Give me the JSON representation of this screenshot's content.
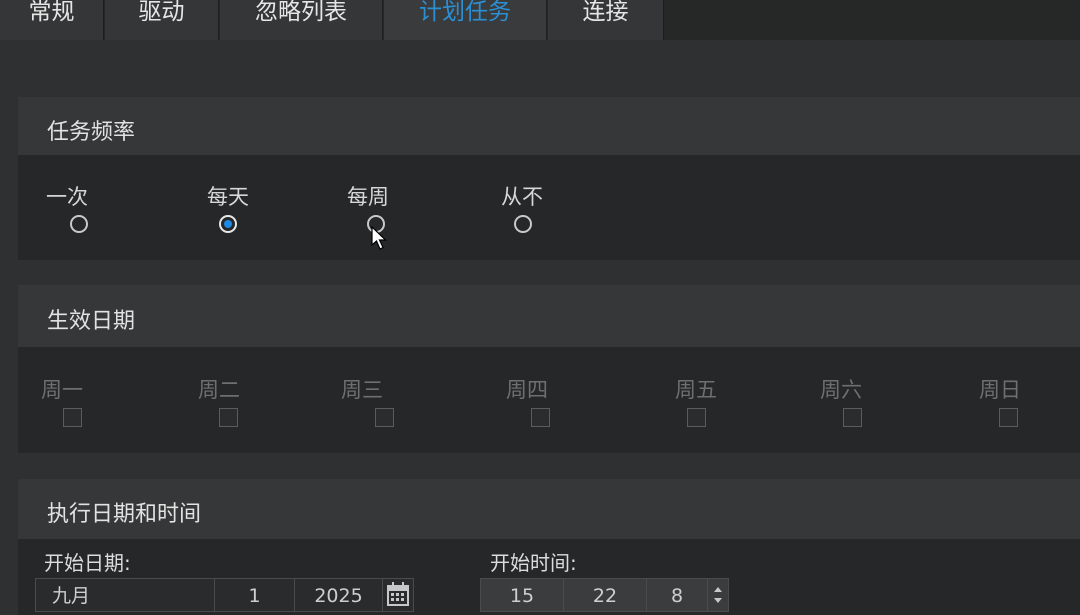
{
  "tabs": [
    {
      "label": "常规",
      "active": false
    },
    {
      "label": "驱动",
      "active": false
    },
    {
      "label": "忽略列表",
      "active": false
    },
    {
      "label": "计划任务",
      "active": true
    },
    {
      "label": "连接",
      "active": false
    }
  ],
  "frequency": {
    "title": "任务频率",
    "options": [
      "一次",
      "每天",
      "每周",
      "从不"
    ],
    "selected": "每天"
  },
  "effective_days": {
    "title": "生效日期",
    "days": [
      "周一",
      "周二",
      "周三",
      "周四",
      "周五",
      "周六",
      "周日"
    ]
  },
  "schedule": {
    "title": "执行日期和时间",
    "start_date_label": "开始日期:",
    "start_time_label": "开始时间:",
    "month": "九月",
    "day": "1",
    "year": "2025",
    "hour": "15",
    "minute": "22",
    "second": "8"
  },
  "colors": {
    "accent": "#2c8fd4",
    "radio_checked": "#1e88e5"
  }
}
